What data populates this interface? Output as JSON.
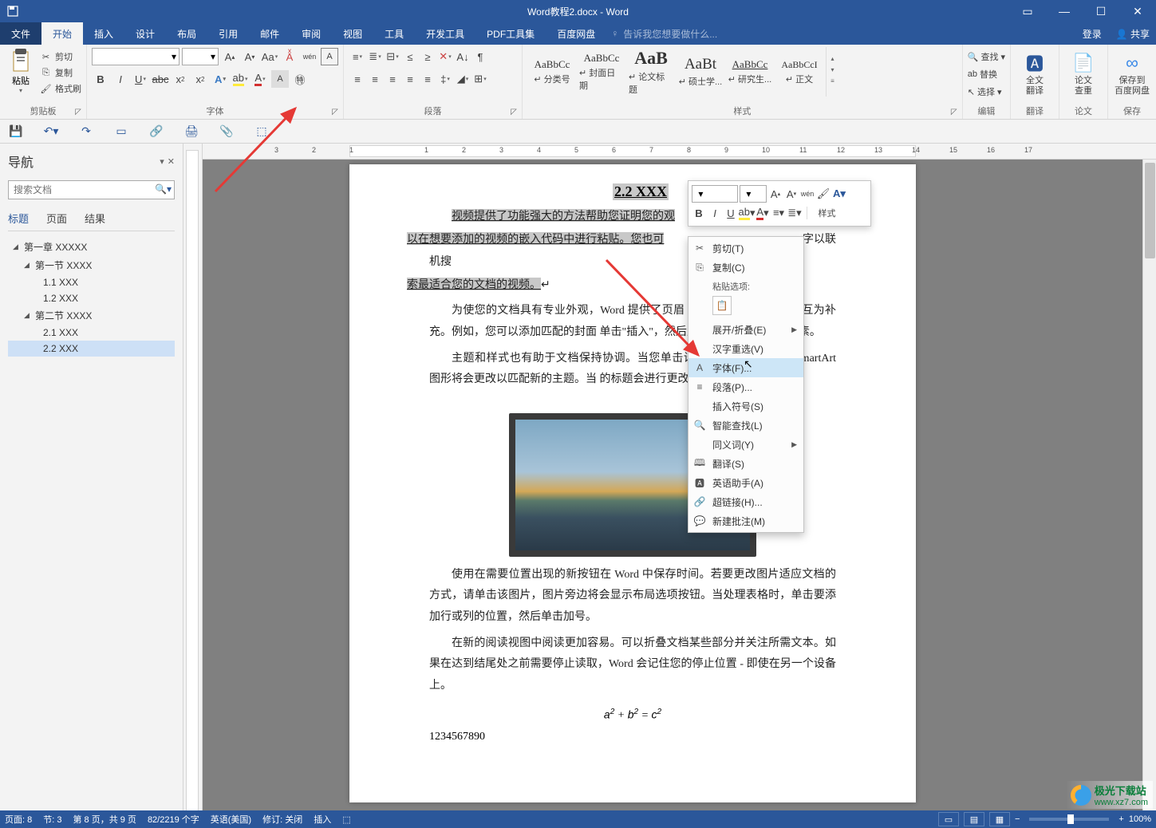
{
  "title": "Word教程2.docx - Word",
  "window": {
    "login": "登录",
    "share": "共享"
  },
  "tabs": [
    "文件",
    "开始",
    "插入",
    "设计",
    "布局",
    "引用",
    "邮件",
    "审阅",
    "视图",
    "工具",
    "开发工具",
    "PDF工具集",
    "百度网盘"
  ],
  "active_tab_index": 1,
  "tell_me": "告诉我您想要做什么...",
  "ribbon": {
    "clipboard": {
      "paste": "粘贴",
      "cut": "剪切",
      "copy": "复制",
      "format_painter": "格式刷",
      "label": "剪贴板"
    },
    "font": {
      "label": "字体"
    },
    "paragraph": {
      "label": "段落"
    },
    "styles": {
      "label": "样式",
      "items": [
        {
          "preview": "AaBbCc",
          "label": "↵ 分类号",
          "size": "13px"
        },
        {
          "preview": "AaBbCc",
          "label": "↵ 封面日期",
          "size": "13px"
        },
        {
          "preview": "AaB",
          "label": "↵ 论文标题",
          "size": "22px",
          "bold": true
        },
        {
          "preview": "AaBt",
          "label": "↵ 硕士学...",
          "size": "19px"
        },
        {
          "preview": "AaBbCc",
          "label": "↵ 研究生...",
          "size": "13px",
          "under": true
        },
        {
          "preview": "AaBbCcI",
          "label": "↵ 正文",
          "size": "12px"
        }
      ]
    },
    "edit": {
      "find": "查找",
      "replace": "替换",
      "select": "选择",
      "label": "编辑"
    },
    "translate_full": {
      "l1": "全文",
      "l2": "翻译",
      "label": "翻译"
    },
    "translate_review": {
      "l1": "论文",
      "l2": "查重",
      "label": "论文"
    },
    "save_baidu": {
      "l1": "保存到",
      "l2": "百度网盘",
      "label": "保存"
    }
  },
  "nav": {
    "title": "导航",
    "search_placeholder": "搜索文档",
    "tabs": [
      "标题",
      "页面",
      "结果"
    ],
    "tree": {
      "ch1": "第一章 XXXXX",
      "s1": "第一节 XXXX",
      "s1_1": "1.1 XXX",
      "s1_2": "1.2 XXX",
      "s2": "第二节 XXXX",
      "s2_1": "2.1 XXX",
      "s2_2": "2.2 XXX"
    }
  },
  "doc": {
    "heading": "2.2 XXX",
    "p1a": "视频提供了功能强大的方法帮助您证明您的观",
    "p1b": "以在想要添加的视频的嵌入代码中进行粘贴。您也可",
    "p1c": "索最适合您的文档的视频。",
    "p1d": "字以联机搜",
    "p2": "为使您的文档具有专业外观，Word 提供了页眉                          本框设计，这些设计可互为补充。例如，您可以添加匹配的封面                          单击\"插入\"，然后从不同库中选择所需元素。",
    "p3": "主题和样式也有助于文档保持协调。当您单击设                          时，图片、图表或 SmartArt 图形将会更改以匹配新的主题。当                          的标题会进行更改以匹配新的主题。",
    "p4": "使用在需要位置出现的新按钮在 Word 中保存时间。若要更改图片适应文档的方式，请单击该图片，图片旁边将会显示布局选项按钮。当处理表格时，单击要添加行或列的位置，然后单击加号。",
    "p5": "在新的阅读视图中阅读更加容易。可以折叠文档某些部分并关注所需文本。如果在达到结尾处之前需要停止读取，Word 会记住您的停止位置 - 即使在另一个设备上。",
    "formula": "a² + b² = c²",
    "numbers": "1234567890"
  },
  "mini_toolbar": {
    "styles": "样式"
  },
  "context_menu": {
    "cut": "剪切(T)",
    "copy": "复制(C)",
    "paste_label": "粘贴选项:",
    "expand": "展开/折叠(E)",
    "hanzi": "汉字重选(V)",
    "font": "字体(F)...",
    "paragraph": "段落(P)...",
    "symbol": "插入符号(S)",
    "smart_lookup": "智能查找(L)",
    "synonym": "同义词(Y)",
    "translate": "翻译(S)",
    "eng_assist": "英语助手(A)",
    "hyperlink": "超链接(H)...",
    "new_comment": "新建批注(M)"
  },
  "status": {
    "pages": "页面: 8",
    "section": "节: 3",
    "page_of": "第 8 页，共 9 页",
    "words": "82/2219 个字",
    "lang": "英语(美国)",
    "track": "修订: 关闭",
    "insert": "插入",
    "zoom": "100%"
  },
  "ruler_ticks": [
    "3",
    "2",
    "1",
    "",
    "1",
    "2",
    "3",
    "4",
    "5",
    "6",
    "7",
    "8",
    "9",
    "10",
    "11",
    "12",
    "13",
    "14",
    "15",
    "16",
    "17"
  ],
  "watermark": {
    "site1": "极光下载站",
    "site2": "www.xz7.com"
  }
}
